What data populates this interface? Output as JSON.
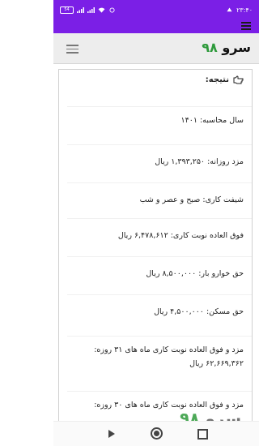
{
  "status_bar": {
    "time": "۲۳:۴۰",
    "battery": "54"
  },
  "app": {
    "logo_text": "سرو",
    "logo_number": "۹۸"
  },
  "result": {
    "header": "نتیجه:",
    "rows": [
      {
        "label": "سال محاسبه:",
        "value": "۱۴۰۱"
      },
      {
        "label": "مزد روزانه:",
        "value": "۱,۳۹۳,۲۵۰ ریال"
      },
      {
        "label": "شیفت کاری:",
        "value": "صبح و عصر و شب"
      },
      {
        "label": "فوق العاده نوبت کاری:",
        "value": "۶,۴۷۸,۶۱۲ ریال"
      },
      {
        "label": "حق خوارو بار:",
        "value": "۸,۵۰۰,۰۰۰ ریال"
      },
      {
        "label": "حق مسکن:",
        "value": "۴,۵۰۰,۰۰۰ ریال"
      },
      {
        "label": "مزد و فوق العاده نوبت کاری ماه های ۳۱ روزه:",
        "value": "۶۲,۶۶۹,۳۶۲ ریال"
      },
      {
        "label": "مزد و فوق العاده نوبت کاری ماه های ۳۰ روزه:",
        "value": ""
      }
    ]
  },
  "watermark": {
    "text": "سرو",
    "number": "۹۸"
  }
}
